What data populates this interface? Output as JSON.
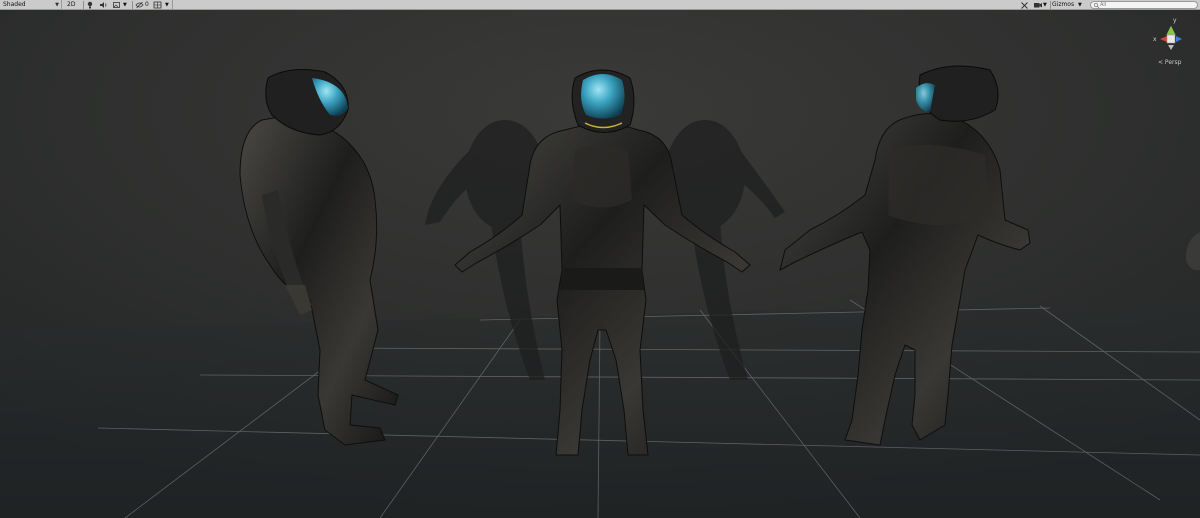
{
  "toolbar": {
    "shading_mode": "Shaded",
    "mode_2d": "2D",
    "fx_count": "0",
    "gizmos_label": "Gizmos",
    "search_placeholder": "All"
  },
  "scene": {
    "axes": {
      "x": "x",
      "y": "y"
    },
    "projection_label": "< Persp"
  },
  "colors": {
    "toolbar_bg": "#cbcbcb",
    "scene_bg": "#2b2b2b",
    "axis_x": "#d9422f",
    "axis_y": "#8bc34a",
    "axis_z": "#3f7fd9",
    "visor": "#3aa2c0"
  },
  "icons": [
    "light-icon",
    "audio-icon",
    "effects-icon",
    "hidden-objects-icon",
    "grid-visibility-icon",
    "tools-icon",
    "camera-icon",
    "search-icon"
  ]
}
